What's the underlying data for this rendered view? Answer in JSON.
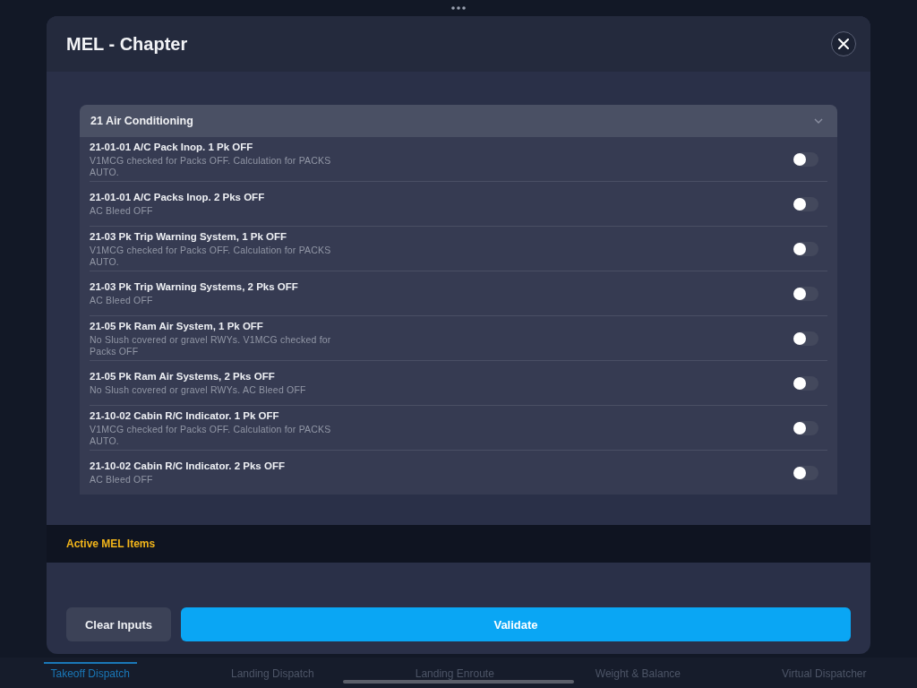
{
  "dialog": {
    "title": "MEL - Chapter"
  },
  "section": {
    "title": "21 Air Conditioning",
    "expanded": true,
    "items": [
      {
        "title": "21-01-01 A/C Pack Inop. 1 Pk OFF",
        "note": "V1MCG checked for Packs OFF. Calculation for PACKS AUTO.",
        "on": false
      },
      {
        "title": "21-01-01 A/C Packs Inop. 2 Pks OFF",
        "note": "AC Bleed OFF",
        "on": false
      },
      {
        "title": "21-03 Pk Trip Warning System, 1 Pk OFF",
        "note": "V1MCG checked for Packs OFF. Calculation for PACKS AUTO.",
        "on": false
      },
      {
        "title": "21-03 Pk Trip Warning Systems, 2 Pks OFF",
        "note": "AC Bleed OFF",
        "on": false
      },
      {
        "title": "21-05 Pk Ram Air System, 1 Pk OFF",
        "note": "No Slush covered or gravel RWYs. V1MCG checked for Packs OFF",
        "on": false
      },
      {
        "title": "21-05 Pk Ram Air Systems, 2 Pks OFF",
        "note": "No Slush covered or gravel RWYs. AC Bleed OFF",
        "on": false
      },
      {
        "title": "21-10-02 Cabin R/C Indicator. 1 Pk OFF",
        "note": "V1MCG checked for Packs OFF. Calculation for PACKS AUTO.",
        "on": false
      },
      {
        "title": "21-10-02 Cabin R/C Indicator. 2 Pks OFF",
        "note": "AC Bleed OFF",
        "on": false
      }
    ]
  },
  "active_items": {
    "title": "Active MEL Items"
  },
  "buttons": {
    "clear": "Clear Inputs",
    "validate": "Validate"
  },
  "tab_bar": [
    {
      "label": "Takeoff Dispatch",
      "selected": true
    },
    {
      "label": "Landing Dispatch",
      "selected": false
    },
    {
      "label": "Landing Enroute",
      "selected": false
    },
    {
      "label": "Weight & Balance",
      "selected": false
    },
    {
      "label": "Virtual Dispatcher",
      "selected": false
    }
  ]
}
